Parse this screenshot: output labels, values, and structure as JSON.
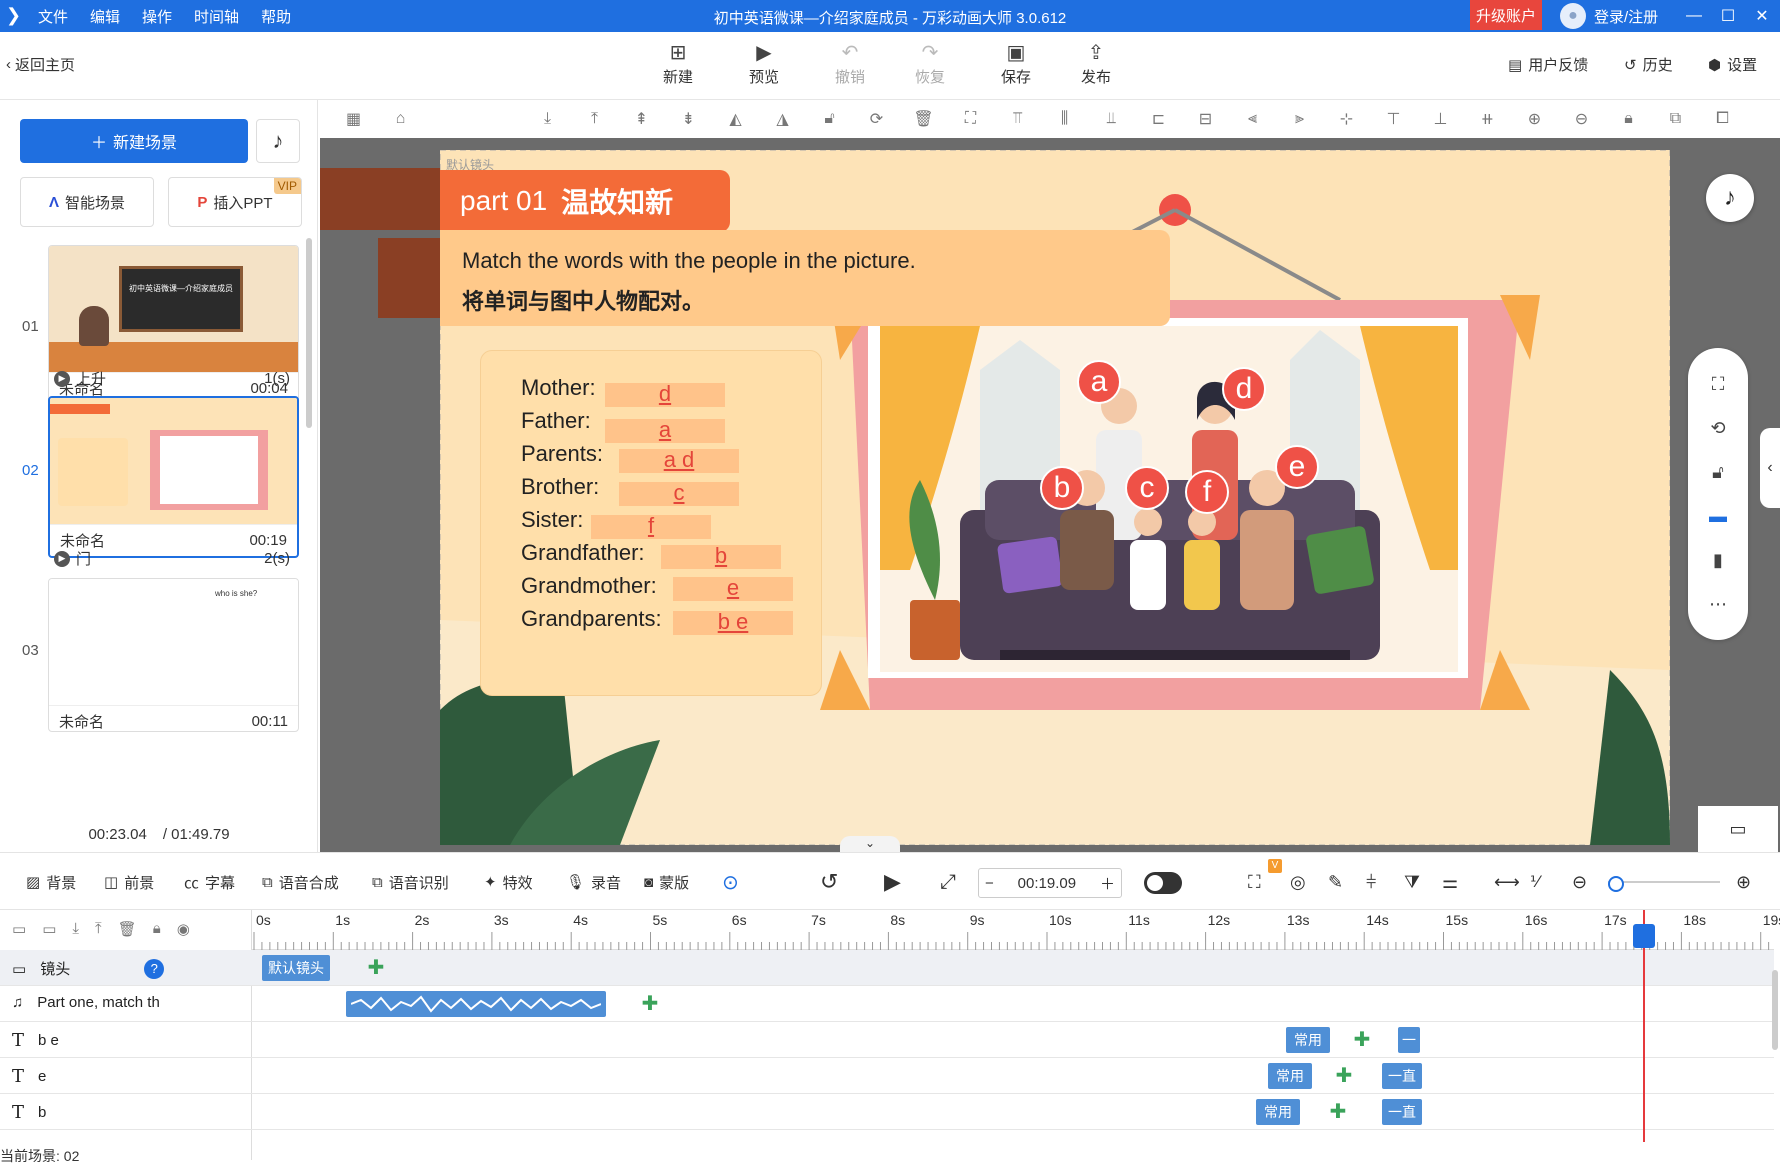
{
  "titlebar": {
    "menu": [
      "文件",
      "编辑",
      "操作",
      "时间轴",
      "帮助"
    ],
    "title": "初中英语微课—介绍家庭成员 - 万彩动画大师 3.0.612",
    "upgrade": "升级账户",
    "login": "登录/注册"
  },
  "toolbar": {
    "back": "返回主页",
    "new": "新建",
    "preview": "预览",
    "undo": "撤销",
    "redo": "恢复",
    "save": "保存",
    "publish": "发布",
    "feedback": "用户反馈",
    "history": "历史",
    "settings": "设置"
  },
  "left": {
    "new_scene": "新建场景",
    "smart_scene": "智能场景",
    "insert_ppt": "插入PPT",
    "vip": "VIP",
    "scenes": [
      {
        "num": "01",
        "name": "未命名",
        "time": "00:04",
        "thumb_title": "初中英语微课—介绍家庭成员"
      },
      {
        "num": "02",
        "name": "未命名",
        "time": "00:19"
      },
      {
        "num": "03",
        "name": "未命名",
        "time": "00:11",
        "thumb_text": "who is she?"
      }
    ],
    "transitions": [
      {
        "name": "上升",
        "dur": "1(s)"
      },
      {
        "name": "门",
        "dur": "2(s)"
      }
    ],
    "current_time": "00:23.04",
    "total_time": "/ 01:49.79"
  },
  "slide": {
    "camera_label": "默认镜头",
    "part_label": "part 01",
    "part_title": "温故知新",
    "instruction_en": "Match the words with the people in the picture.",
    "instruction_cn": "将单词与图中人物配对。",
    "words": [
      {
        "label": "Mother:",
        "answer": "d"
      },
      {
        "label": "Father:",
        "answer": "a"
      },
      {
        "label": "Parents:",
        "answer": "a  d"
      },
      {
        "label": "Brother:",
        "answer": "c"
      },
      {
        "label": "Sister:",
        "answer": "f"
      },
      {
        "label": "Grandfather:",
        "answer": "b"
      },
      {
        "label": "Grandmother:",
        "answer": "e"
      },
      {
        "label": "Grandparents:",
        "answer": "b  e"
      }
    ],
    "markers": [
      "a",
      "d",
      "b",
      "c",
      "f",
      "e"
    ]
  },
  "bottomtools": {
    "background": "背景",
    "foreground": "前景",
    "subtitle": "字幕",
    "tts": "语音合成",
    "asr": "语音识别",
    "effects": "特效",
    "record": "录音",
    "mask": "蒙版",
    "time": "00:19.09",
    "v_badge": "V"
  },
  "timeline": {
    "ruler": [
      "0s",
      "1s",
      "2s",
      "3s",
      "4s",
      "5s",
      "6s",
      "7s",
      "8s",
      "9s",
      "10s",
      "11s",
      "12s",
      "13s",
      "14s",
      "15s",
      "16s",
      "17s",
      "18s",
      "19s"
    ],
    "tracks": [
      {
        "name": "镜头",
        "clip": "默认镜头"
      },
      {
        "name": "Part one, match th"
      },
      {
        "name": "b  e",
        "clip": "常用",
        "end": "一"
      },
      {
        "name": "e",
        "clip": "常用",
        "end": "一直"
      },
      {
        "name": "b",
        "clip": "常用",
        "end": "一直"
      }
    ],
    "current_scene": "当前场景: 02"
  }
}
